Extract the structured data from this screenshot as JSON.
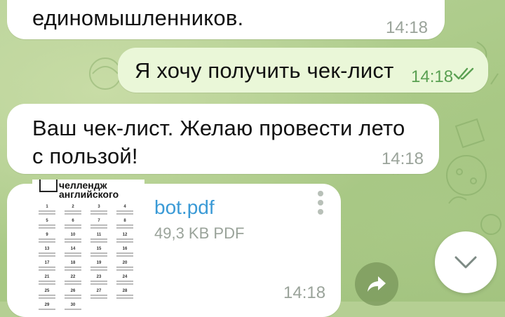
{
  "messages": [
    {
      "id": "m1",
      "direction": "in",
      "text": "единомышленников.",
      "time": "14:18"
    },
    {
      "id": "m2",
      "direction": "out",
      "text": "Я хочу получить чек-лист",
      "time": "14:18",
      "status": "read"
    },
    {
      "id": "m3",
      "direction": "in",
      "lines": [
        "Ваш чек-лист. Желаю провести лето",
        "с пользой!"
      ],
      "time": "14:18"
    }
  ],
  "file_message": {
    "file_name": "bot.pdf",
    "file_size": "49,3 KB PDF",
    "time": "14:18",
    "thumbnail_title": [
      "челлендж",
      "английского"
    ],
    "thumbnail_days": [
      "1",
      "2",
      "3",
      "4",
      "5",
      "6",
      "7",
      "8",
      "9",
      "10",
      "11",
      "12",
      "13",
      "14",
      "15",
      "16",
      "17",
      "18",
      "19",
      "20",
      "21",
      "22",
      "23",
      "24",
      "25",
      "26",
      "27",
      "28",
      "29",
      "30"
    ]
  },
  "icons": {
    "read_check": "double-check-icon",
    "share": "share-arrow-icon",
    "scroll_down": "chevron-down-icon",
    "file_menu": "more-vertical-icon"
  },
  "colors": {
    "outgoing_bubble": "#eaf7d8",
    "incoming_bubble": "#ffffff",
    "file_name": "#3a9ad6",
    "outgoing_time": "#5aa052",
    "chat_background": "#b5cf93"
  }
}
